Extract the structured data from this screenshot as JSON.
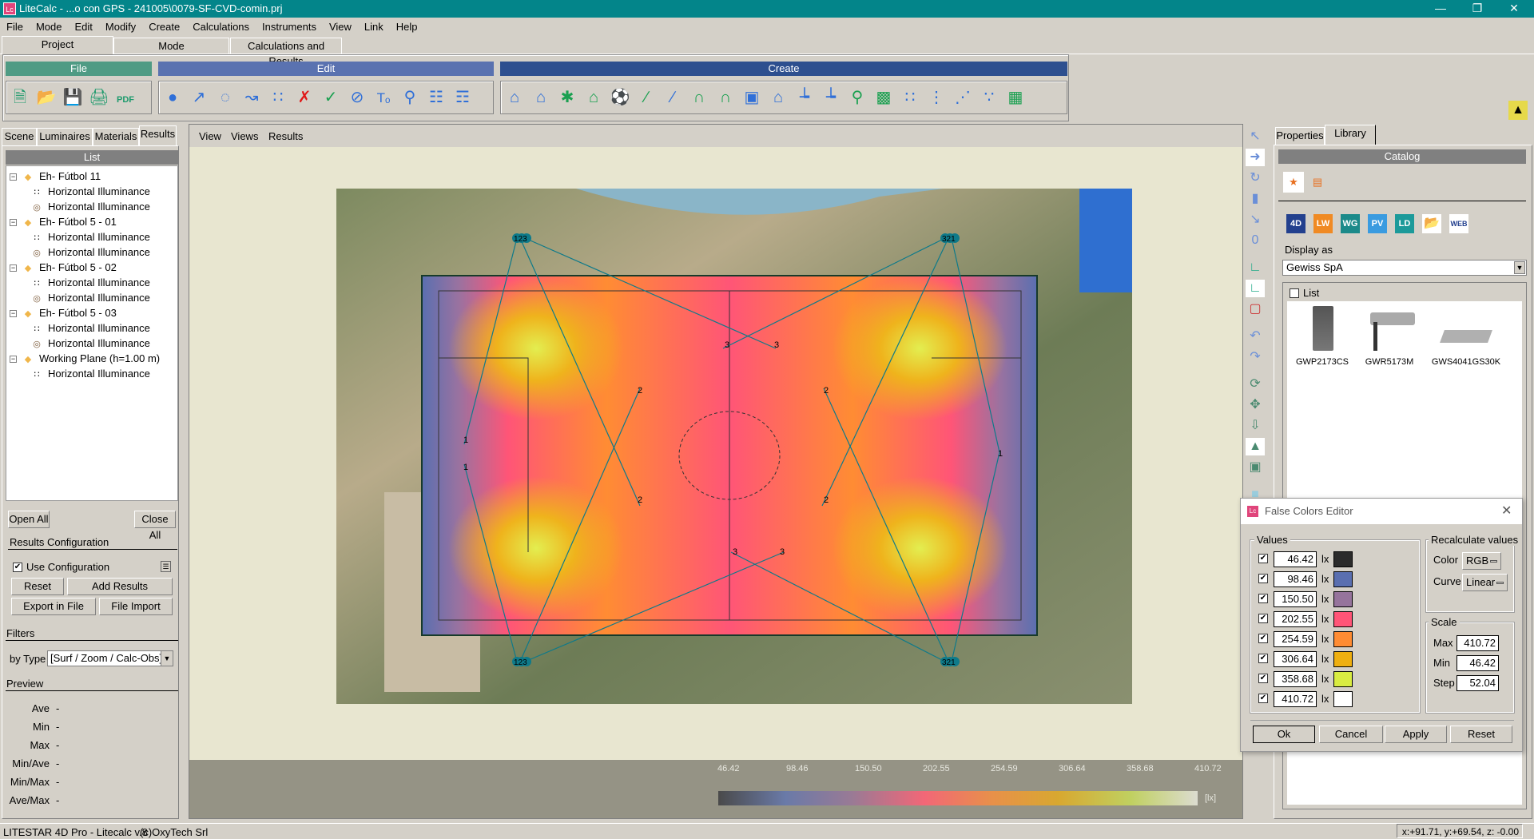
{
  "window": {
    "app_icon": "Lc",
    "title": "LiteCalc - ...o con GPS - 241005\\0079-SF-CVD-comin.prj",
    "minimize_icon": "minimize-icon",
    "restore_icon": "restore-icon",
    "close_icon": "close-icon"
  },
  "menu": [
    "File",
    "Mode",
    "Edit",
    "Modify",
    "Create",
    "Calculations",
    "Instruments",
    "View",
    "Link",
    "Help"
  ],
  "ribbon_tabs": [
    "Project",
    "Mode",
    "Calculations and Results"
  ],
  "ribbon": {
    "groups": [
      {
        "label": "File",
        "color": "#4f9b84",
        "icons": [
          "new-file-icon",
          "open-folder-icon",
          "save-icon",
          "print-icon",
          "pdf-icon"
        ]
      },
      {
        "label": "Edit",
        "color": "#5a72b0",
        "icons": [
          "add-point-icon",
          "line-points-icon",
          "circle-points-icon",
          "path-points-icon",
          "grid-points-icon",
          "delete-points-icon",
          "validate-points-icon",
          "detach-icon",
          "text-icon",
          "group-icon",
          "hierarchy-icon",
          "remove-hierarchy-icon"
        ]
      },
      {
        "label": "Create",
        "color": "#2d4f8f",
        "icons": [
          "building-road-icon",
          "house-icon",
          "outdoor-area-icon",
          "outdoor-house-icon",
          "football-icon",
          "road-icon",
          "road-lanes-icon",
          "tunnel-road-icon",
          "tunnel-icon",
          "room-icon",
          "house-room-icon",
          "surface-icon",
          "surface-polygon-icon",
          "luminaire-pole-icon",
          "wall-surface-icon",
          "grid-array-icon",
          "circle-array-icon",
          "line-array-icon",
          "pair-array-icon",
          "quad-array-icon"
        ]
      }
    ],
    "lamp_icon": "lamp-icon"
  },
  "left_panel": {
    "tabs": [
      "Scene",
      "Luminaires",
      "Materials",
      "Results"
    ],
    "active_tab": "Results",
    "list_header": "List",
    "tree": [
      {
        "label": "Eh- Fútbol 11",
        "level": 0
      },
      {
        "label": "Horizontal Illuminance",
        "level": 1,
        "icon": "values-grid-icon"
      },
      {
        "label": "Horizontal Illuminance",
        "level": 1,
        "icon": "isolines-icon"
      },
      {
        "label": "Eh- Fútbol 5 - 01",
        "level": 0
      },
      {
        "label": "Horizontal Illuminance",
        "level": 1,
        "icon": "values-grid-icon"
      },
      {
        "label": "Horizontal Illuminance",
        "level": 1,
        "icon": "isolines-icon"
      },
      {
        "label": "Eh- Fútbol 5 - 02",
        "level": 0
      },
      {
        "label": "Horizontal Illuminance",
        "level": 1,
        "icon": "values-grid-icon"
      },
      {
        "label": "Horizontal Illuminance",
        "level": 1,
        "icon": "isolines-icon"
      },
      {
        "label": "Eh- Fútbol 5 - 03",
        "level": 0
      },
      {
        "label": "Horizontal Illuminance",
        "level": 1,
        "icon": "values-grid-icon"
      },
      {
        "label": "Horizontal Illuminance",
        "level": 1,
        "icon": "isolines-icon"
      },
      {
        "label": "Working Plane (h=1.00 m)",
        "level": 0
      },
      {
        "label": "Horizontal Illuminance",
        "level": 1,
        "icon": "values-grid-icon"
      }
    ],
    "open_all": "Open All",
    "close_all": "Close All",
    "results_config": "Results Configuration",
    "use_config": "Use Configuration",
    "use_config_checked": true,
    "reset": "Reset",
    "add_results": "Add Results",
    "export_file": "Export in File",
    "file_import": "File Import",
    "filters": "Filters",
    "by_type_label": "by Type",
    "by_type_value": "[Surf / Zoom / Calc-Obs]",
    "preview": "Preview",
    "preview_rows": [
      {
        "label": "Ave",
        "value": "-"
      },
      {
        "label": "Min",
        "value": "-"
      },
      {
        "label": "Max",
        "value": "-"
      },
      {
        "label": "Min/Ave",
        "value": "-"
      },
      {
        "label": "Min/Max",
        "value": "-"
      },
      {
        "label": "Ave/Max",
        "value": "-"
      }
    ]
  },
  "view": {
    "menu": [
      "View",
      "Views",
      "Results"
    ],
    "pole_labels": [
      "123",
      "321",
      "123",
      "321"
    ],
    "aim_labels": [
      "3",
      "3",
      "2",
      "2",
      "2",
      "2",
      "1",
      "1",
      "1",
      "3",
      "3"
    ],
    "legend": {
      "ticks": [
        "46.42",
        "98.46",
        "150.50",
        "202.55",
        "254.59",
        "306.64",
        "358.68",
        "410.72"
      ],
      "unit": "[lx]"
    }
  },
  "right_panel": {
    "tabs": [
      "Properties",
      "Library"
    ],
    "active_tab": "Library",
    "catalog_header": "Catalog",
    "source_icons": [
      {
        "label": "4D",
        "color": "#23408e"
      },
      {
        "label": "LW",
        "color": "#f08a24"
      },
      {
        "label": "WG",
        "color": "#1c8a8a"
      },
      {
        "label": "PV",
        "color": "#3a9be0"
      },
      {
        "label": "LD",
        "color": "#1c9a9a"
      }
    ],
    "display_as_label": "Display as",
    "display_as_value": "Gewiss SpA",
    "list_label": "List",
    "list_checked": false,
    "products": [
      "GWP2173CS",
      "GWR5173M",
      "GWS4041GS30K"
    ]
  },
  "dialog": {
    "title": "False Colors Editor",
    "values_label": "Values",
    "unit": "lx",
    "rows": [
      {
        "value": "46.42",
        "color": "#2b2b2b",
        "checked": true
      },
      {
        "value": "98.46",
        "color": "#5a6fb0",
        "checked": true
      },
      {
        "value": "150.50",
        "color": "#96749c",
        "checked": true
      },
      {
        "value": "202.55",
        "color": "#ff5577",
        "checked": true
      },
      {
        "value": "254.59",
        "color": "#ff8c33",
        "checked": true
      },
      {
        "value": "306.64",
        "color": "#eeaf10",
        "checked": true
      },
      {
        "value": "358.68",
        "color": "#d9ec42",
        "checked": true
      },
      {
        "value": "410.72",
        "color": "#ffffff",
        "checked": true
      }
    ],
    "recalc_label": "Recalculate values",
    "color_label": "Color",
    "color_value": "RGB",
    "curve_label": "Curve",
    "curve_value": "Linear",
    "scale_label": "Scale",
    "max_label": "Max",
    "max_value": "410.72",
    "min_label": "Min",
    "min_value": "46.42",
    "step_label": "Step",
    "step_value": "52.04",
    "ok": "Ok",
    "cancel": "Cancel",
    "apply": "Apply",
    "reset": "Reset"
  },
  "status": {
    "left": "LITESTAR 4D Pro - Litecalc v.8",
    "company": "(c)OxyTech Srl",
    "coords": "x:+91.71, y:+69.54, z: -0.00"
  }
}
